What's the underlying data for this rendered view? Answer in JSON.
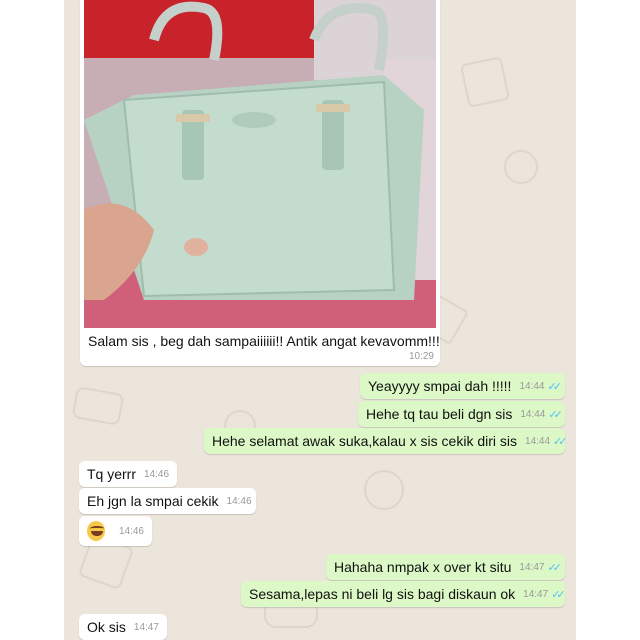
{
  "chat": {
    "photo_message": {
      "caption": "Salam sis , beg dah sampaiiiiii!! Antik angat kevavomm!!!",
      "time": "10:29"
    },
    "messages": [
      {
        "dir": "out",
        "text": "Yeayyyy smpai dah !!!!!",
        "time": "14:44"
      },
      {
        "dir": "out",
        "text": "Hehe tq tau beli dgn sis",
        "time": "14:44"
      },
      {
        "dir": "out",
        "text": "Hehe selamat awak suka,kalau x sis cekik diri sis",
        "time": "14:44"
      },
      {
        "dir": "in",
        "text": "Tq yerrr",
        "time": "14:46"
      },
      {
        "dir": "in",
        "text": "Eh jgn la smpai cekik",
        "time": "14:46"
      },
      {
        "dir": "in",
        "emoji": "laughing-tears-emoji",
        "time": "14:46"
      },
      {
        "dir": "out",
        "text": "Hahaha nmpak x over kt situ",
        "time": "14:47"
      },
      {
        "dir": "out",
        "text": "Sesama,lepas ni beli lg sis bagi diskaun ok",
        "time": "14:47"
      },
      {
        "dir": "in",
        "text": "Ok sis",
        "time": "14:47"
      }
    ],
    "read_ticks": "✓✓"
  },
  "colors": {
    "outgoing_bubble": "#dcf8c6",
    "incoming_bubble": "#ffffff",
    "chat_background": "#ece5dc",
    "read_tick": "#4fc3f7"
  }
}
